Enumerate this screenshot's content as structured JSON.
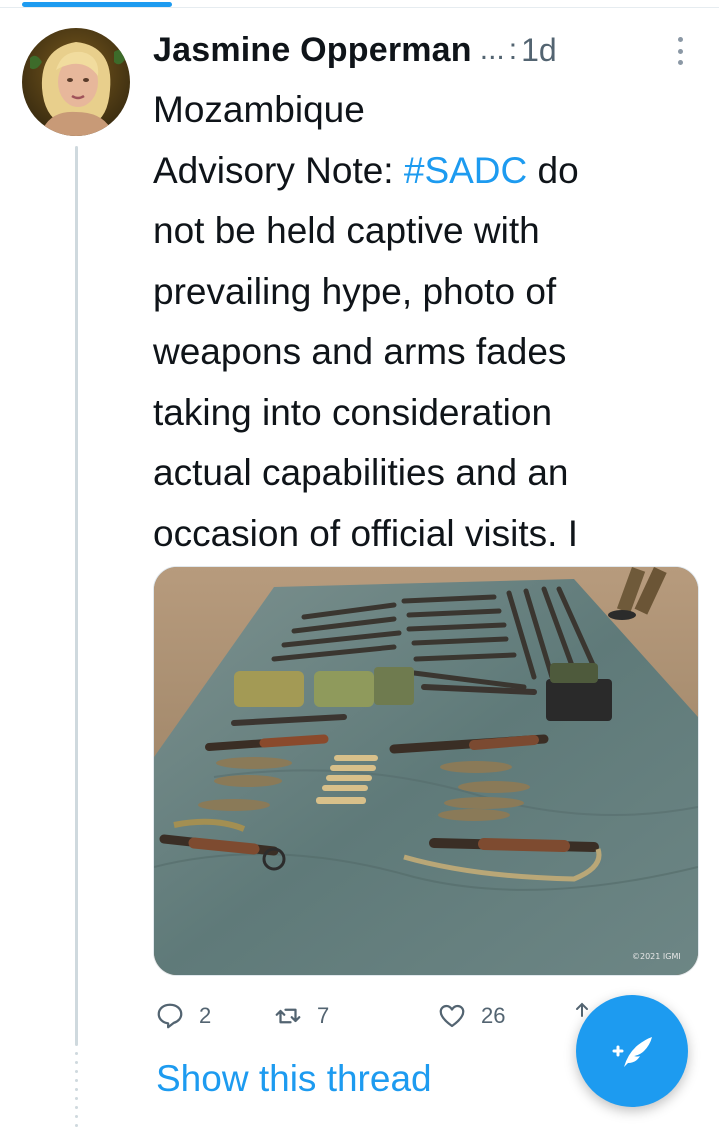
{
  "tweet": {
    "author_name": "Jasmine Opperman",
    "handle": "...",
    "separator": ":",
    "time": "1d",
    "text_lines": [
      {
        "before": "Mozambique",
        "hashtag": "",
        "after": ""
      },
      {
        "before": "Advisory Note: ",
        "hashtag": "#SADC",
        "after": " do"
      },
      {
        "before": "not be held captive with",
        "hashtag": "",
        "after": ""
      },
      {
        "before": "prevailing hype, photo of",
        "hashtag": "",
        "after": ""
      },
      {
        "before": "weapons and arms fades",
        "hashtag": "",
        "after": ""
      },
      {
        "before": "taking into consideration",
        "hashtag": "",
        "after": ""
      },
      {
        "before": "actual capabilities and an",
        "hashtag": "",
        "after": ""
      },
      {
        "before": "occasion of official visits. I",
        "hashtag": "",
        "after": ""
      }
    ],
    "media_watermark": "©2021 IGMI",
    "counts": {
      "replies": "2",
      "retweets": "7",
      "likes": "26"
    },
    "show_thread": "Show this thread"
  },
  "icons": {
    "more": "more-vertical-icon",
    "reply": "reply-icon",
    "retweet": "retweet-icon",
    "like": "heart-icon",
    "share": "share-icon",
    "compose": "compose-feather-icon"
  },
  "colors": {
    "accent": "#1d9bf0",
    "text": "#0f1419",
    "muted": "#536471",
    "thread_line": "#cfd9de"
  }
}
